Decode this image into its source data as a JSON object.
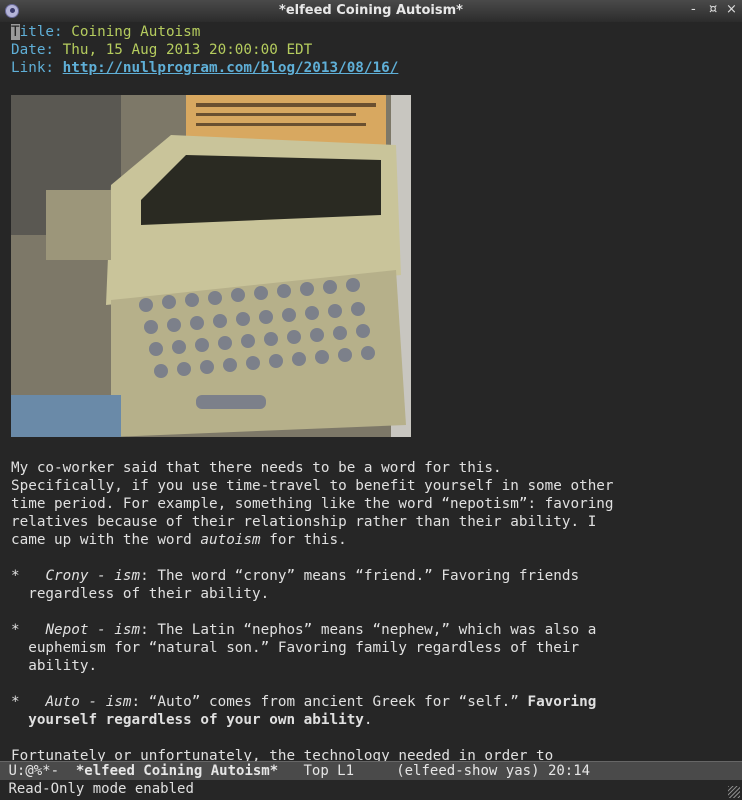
{
  "window": {
    "title": "*elfeed Coining Autoism*",
    "controls": [
      "-",
      "¤",
      "×"
    ]
  },
  "entry": {
    "title_key": "Title:",
    "title_value": "Coining Autoism",
    "date_key": "Date:",
    "date_value": "Thu, 15 Aug 2013 20:00:00 EDT",
    "link_key": "Link:",
    "link_value": "http://nullprogram.com/blog/2013/08/16/"
  },
  "body": {
    "p1": [
      "My co-worker said that there needs to be a word for this.",
      "Specifically, if you use time-travel to benefit yourself in some other",
      "time period. For example, something like the word “nepotism”: favoring",
      "relatives because of their relationship rather than their ability. I"
    ],
    "p1_last_pre": "came up with the word ",
    "p1_last_em": "autoism",
    "p1_last_post": " for this.",
    "items": [
      {
        "bullet": "*",
        "term": "Crony - ism",
        "text1": ": The word “crony” means “friend.” Favoring friends",
        "text2": "regardless of their ability."
      },
      {
        "bullet": "*",
        "term": "Nepot - ism",
        "text1": ": The Latin “nephos” means “nephew,” which was also a",
        "text2": "euphemism for “natural son.” Favoring family regardless of their",
        "text3": "ability."
      },
      {
        "bullet": "*",
        "term": "Auto - ism",
        "text1": ": “Auto” comes from ancient Greek for “self.” ",
        "bold1": "Favoring",
        "bold2": "yourself regardless of your own ability",
        "tail": "."
      }
    ],
    "last_line": "Fortunately or unfortunately, the technology needed in order to"
  },
  "modeline": {
    "status": "U:@%*-",
    "buffer": "*elfeed Coining Autoism*",
    "position": "Top L1",
    "modes": "(elfeed-show yas)",
    "time": "20:14"
  },
  "echo": "Read-Only mode enabled"
}
